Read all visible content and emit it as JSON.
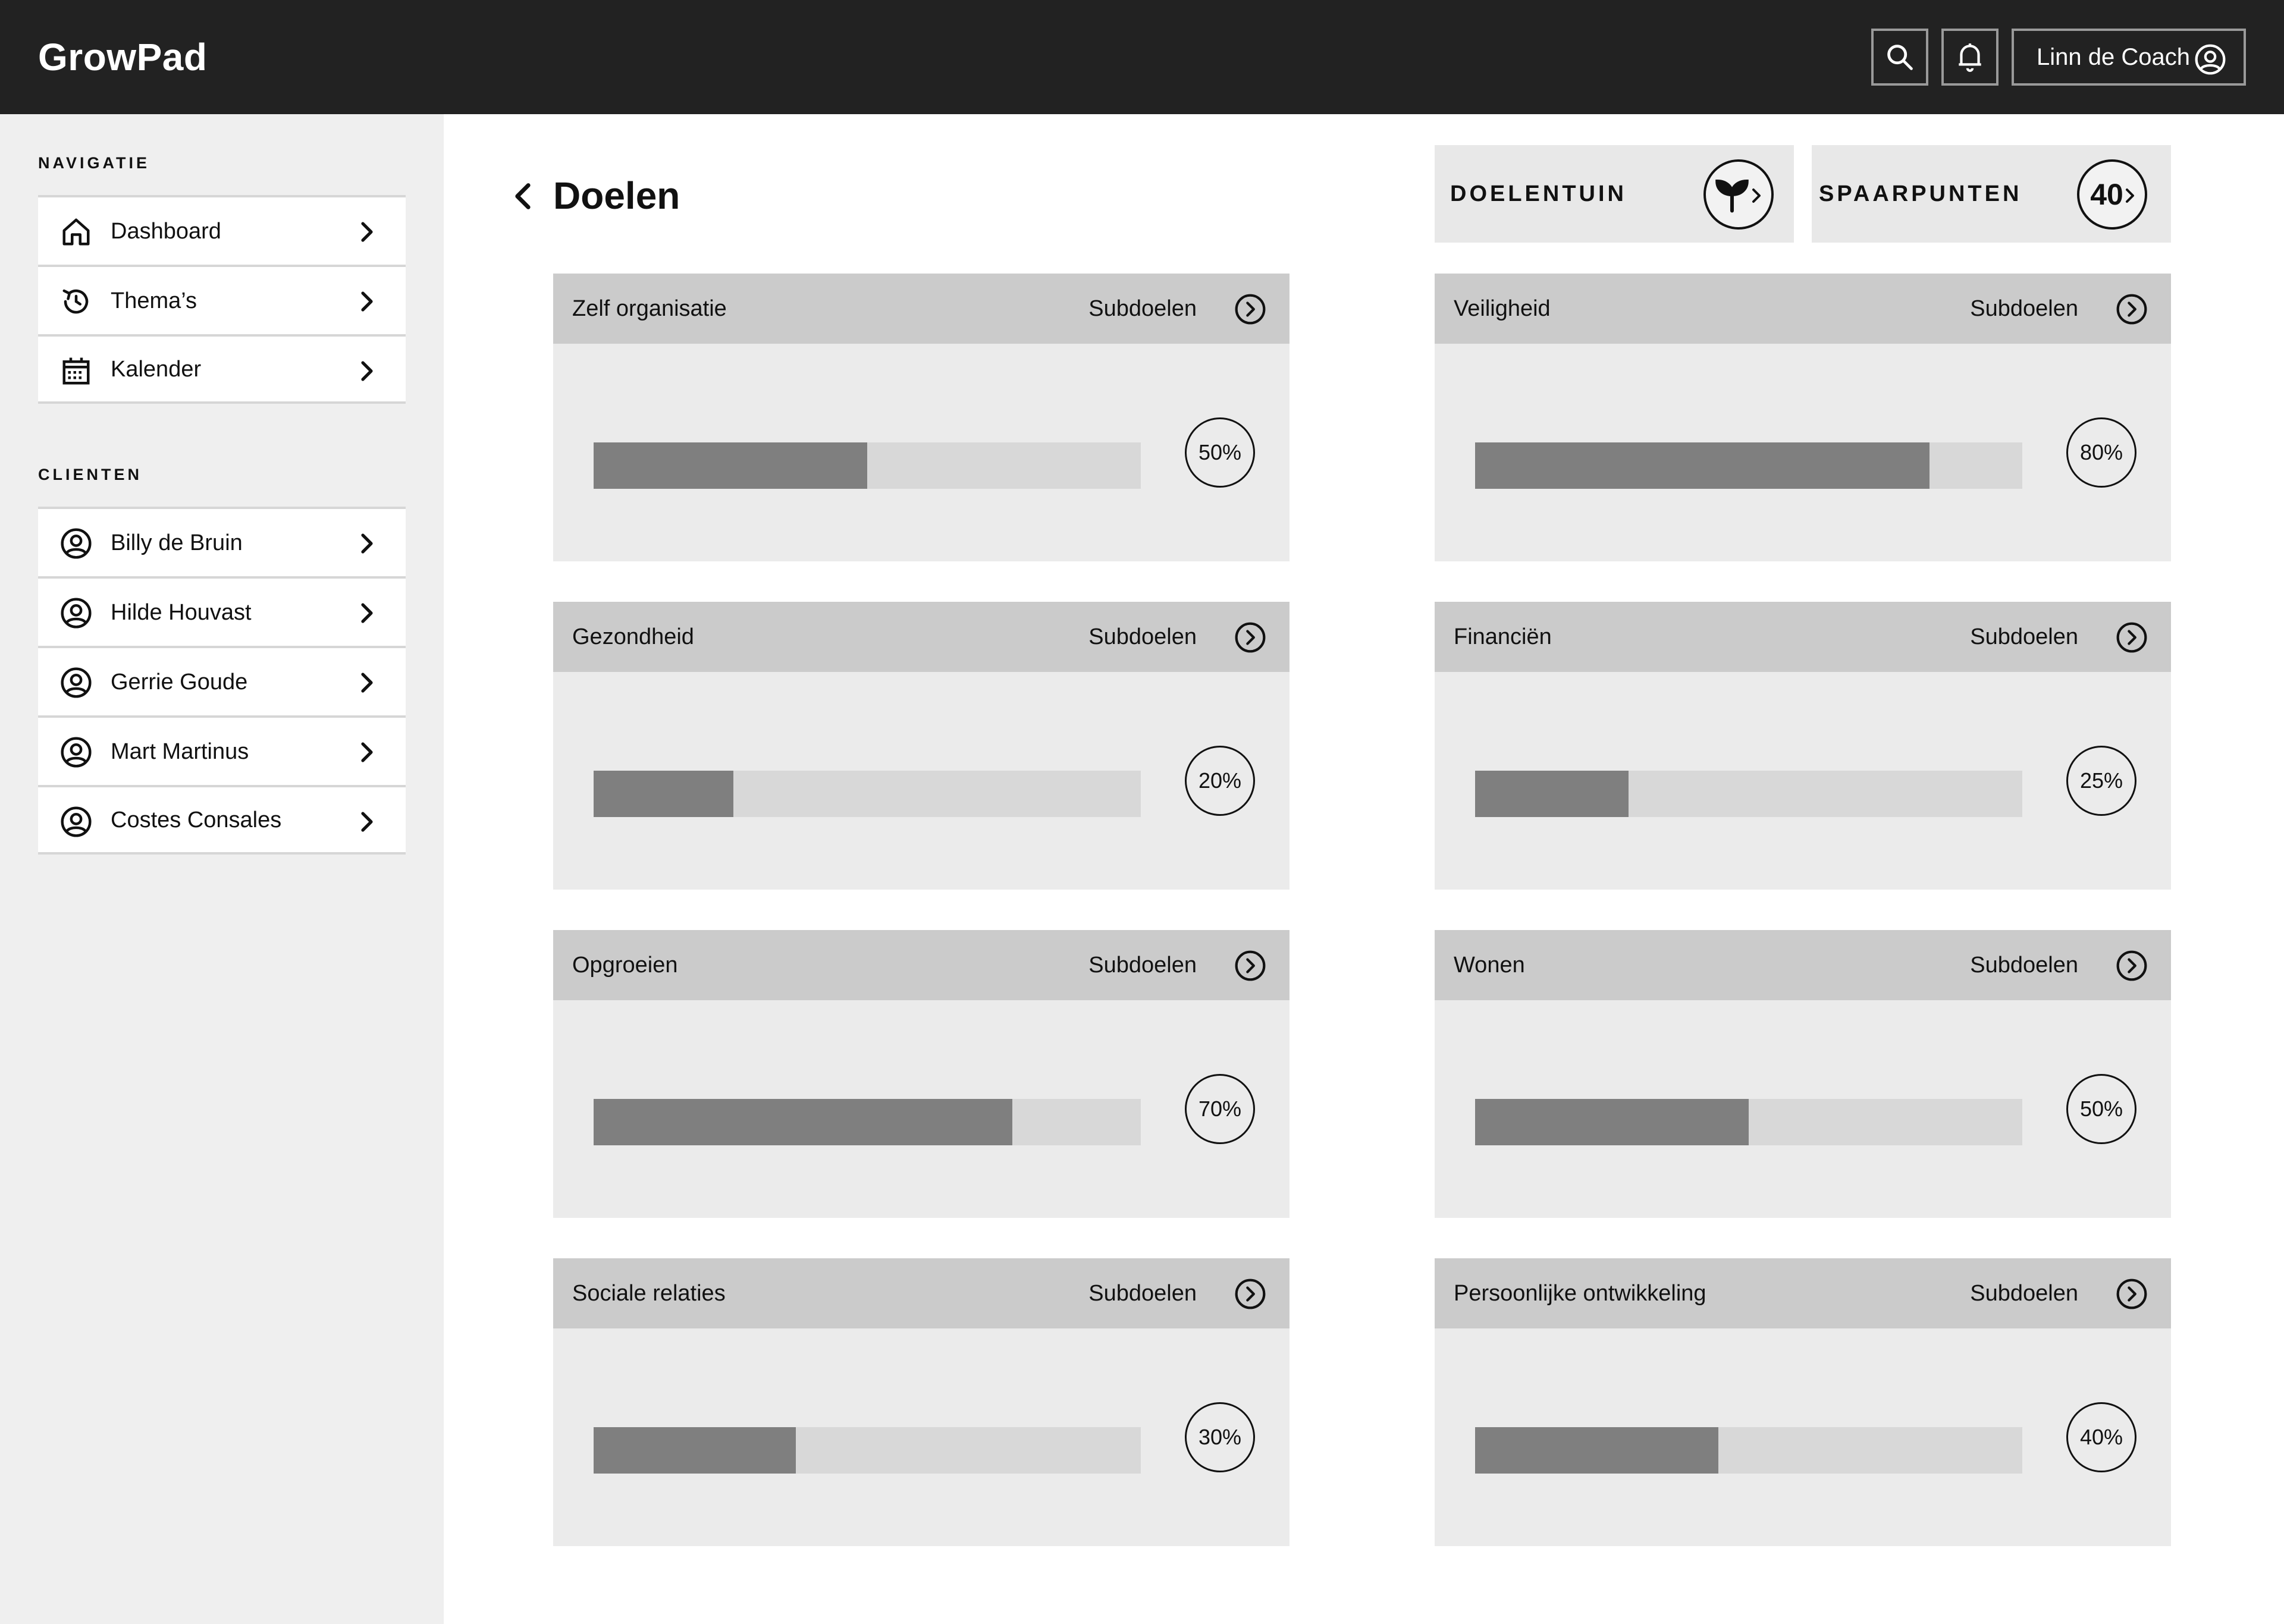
{
  "app": {
    "name": "GrowPad"
  },
  "header": {
    "user_name": "Linn de Coach"
  },
  "sidebar": {
    "nav_title": "NAVIGATIE",
    "nav_items": [
      {
        "label": "Dashboard",
        "icon": "home-icon"
      },
      {
        "label": "Thema’s",
        "icon": "history-icon"
      },
      {
        "label": "Kalender",
        "icon": "calendar-icon"
      }
    ],
    "clients_title": "CLIENTEN",
    "clients": [
      {
        "label": "Billy de Bruin",
        "icon": "user-circle-icon"
      },
      {
        "label": "Hilde Houvast",
        "icon": "user-circle-icon"
      },
      {
        "label": "Gerrie Goude",
        "icon": "user-circle-icon"
      },
      {
        "label": "Mart Martinus",
        "icon": "user-circle-icon"
      },
      {
        "label": "Costes Consales",
        "icon": "user-circle-icon"
      }
    ]
  },
  "main": {
    "title": "Doelen",
    "doelentuin": {
      "label": "DOELENTUIN",
      "icon": "sprout-icon"
    },
    "spaarpunten": {
      "label": "SPAARPUNTEN",
      "value": "40"
    },
    "goals": [
      {
        "name": "Zelf organisatie",
        "sub_label": "Subdoelen",
        "progress": 0.5,
        "percent_label": "50%"
      },
      {
        "name": "Veiligheid",
        "sub_label": "Subdoelen",
        "progress": 0.83,
        "percent_label": "80%"
      },
      {
        "name": "Gezondheid",
        "sub_label": "Subdoelen",
        "progress": 0.255,
        "percent_label": "20%"
      },
      {
        "name": "Financiën",
        "sub_label": "Subdoelen",
        "progress": 0.28,
        "percent_label": "25%"
      },
      {
        "name": "Opgroeien",
        "sub_label": "Subdoelen",
        "progress": 0.765,
        "percent_label": "70%"
      },
      {
        "name": "Wonen",
        "sub_label": "Subdoelen",
        "progress": 0.5,
        "percent_label": "50%"
      },
      {
        "name": "Sociale relaties",
        "sub_label": "Subdoelen",
        "progress": 0.37,
        "percent_label": "30%"
      },
      {
        "name": "Persoonlijke ontwikkeling",
        "sub_label": "Subdoelen",
        "progress": 0.445,
        "percent_label": "40%"
      }
    ]
  },
  "colors": {
    "header_bg": "#222222",
    "sidebar_bg": "#efefef",
    "card_head": "#cbcbcb",
    "card_body": "#ebebeb",
    "bar_fill": "#7f7f7f",
    "bar_track": "#d8d8d8"
  }
}
